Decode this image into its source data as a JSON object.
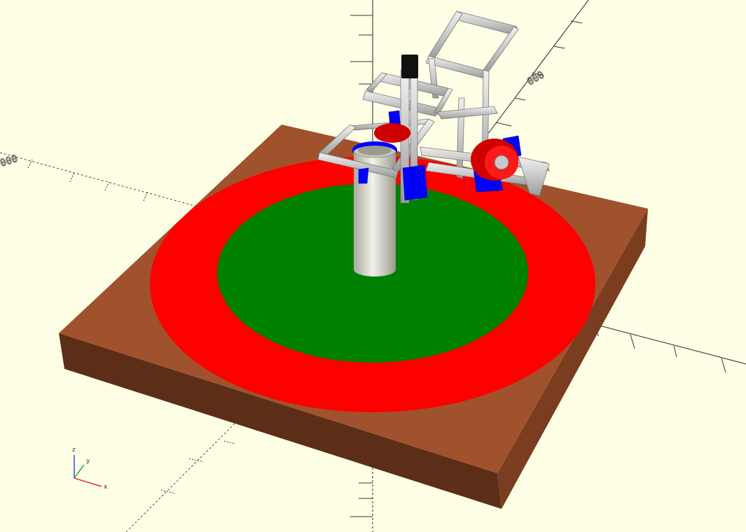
{
  "viewport": {
    "background": "#ffffe5",
    "ruler_label_left": "000",
    "ruler_label_right": "000"
  },
  "scene": {
    "base_color_top": "#a0522d",
    "base_color_front": "#5c2e18",
    "base_color_side": "#7a3d1f",
    "outer_ring_color": "#ff0000",
    "inner_disc_color": "#008000",
    "frame_color": "#d0d0d0",
    "motor_mount_color": "#0000ff",
    "wheel_color": "#e00000",
    "motor_color": "#111111",
    "pillar_color": "#d8d8d0"
  },
  "axes_indicator": {
    "z_label": "z",
    "y_label": "y",
    "x_label": "x",
    "x_color": "#e03030",
    "y_color": "#30b030",
    "z_color": "#3050e0"
  }
}
